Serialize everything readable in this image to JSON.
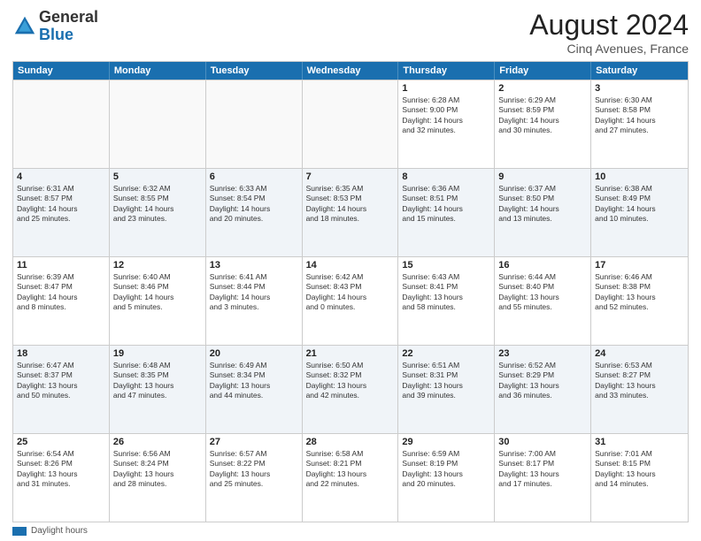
{
  "header": {
    "logo_general": "General",
    "logo_blue": "Blue",
    "month_year": "August 2024",
    "location": "Cinq Avenues, France"
  },
  "calendar": {
    "days_of_week": [
      "Sunday",
      "Monday",
      "Tuesday",
      "Wednesday",
      "Thursday",
      "Friday",
      "Saturday"
    ],
    "rows": [
      {
        "cells": [
          {
            "day": "",
            "info": "",
            "empty": true
          },
          {
            "day": "",
            "info": "",
            "empty": true
          },
          {
            "day": "",
            "info": "",
            "empty": true
          },
          {
            "day": "",
            "info": "",
            "empty": true
          },
          {
            "day": "1",
            "info": "Sunrise: 6:28 AM\nSunset: 9:00 PM\nDaylight: 14 hours\nand 32 minutes."
          },
          {
            "day": "2",
            "info": "Sunrise: 6:29 AM\nSunset: 8:59 PM\nDaylight: 14 hours\nand 30 minutes."
          },
          {
            "day": "3",
            "info": "Sunrise: 6:30 AM\nSunset: 8:58 PM\nDaylight: 14 hours\nand 27 minutes."
          }
        ]
      },
      {
        "alt": true,
        "cells": [
          {
            "day": "4",
            "info": "Sunrise: 6:31 AM\nSunset: 8:57 PM\nDaylight: 14 hours\nand 25 minutes."
          },
          {
            "day": "5",
            "info": "Sunrise: 6:32 AM\nSunset: 8:55 PM\nDaylight: 14 hours\nand 23 minutes."
          },
          {
            "day": "6",
            "info": "Sunrise: 6:33 AM\nSunset: 8:54 PM\nDaylight: 14 hours\nand 20 minutes."
          },
          {
            "day": "7",
            "info": "Sunrise: 6:35 AM\nSunset: 8:53 PM\nDaylight: 14 hours\nand 18 minutes."
          },
          {
            "day": "8",
            "info": "Sunrise: 6:36 AM\nSunset: 8:51 PM\nDaylight: 14 hours\nand 15 minutes."
          },
          {
            "day": "9",
            "info": "Sunrise: 6:37 AM\nSunset: 8:50 PM\nDaylight: 14 hours\nand 13 minutes."
          },
          {
            "day": "10",
            "info": "Sunrise: 6:38 AM\nSunset: 8:49 PM\nDaylight: 14 hours\nand 10 minutes."
          }
        ]
      },
      {
        "cells": [
          {
            "day": "11",
            "info": "Sunrise: 6:39 AM\nSunset: 8:47 PM\nDaylight: 14 hours\nand 8 minutes."
          },
          {
            "day": "12",
            "info": "Sunrise: 6:40 AM\nSunset: 8:46 PM\nDaylight: 14 hours\nand 5 minutes."
          },
          {
            "day": "13",
            "info": "Sunrise: 6:41 AM\nSunset: 8:44 PM\nDaylight: 14 hours\nand 3 minutes."
          },
          {
            "day": "14",
            "info": "Sunrise: 6:42 AM\nSunset: 8:43 PM\nDaylight: 14 hours\nand 0 minutes."
          },
          {
            "day": "15",
            "info": "Sunrise: 6:43 AM\nSunset: 8:41 PM\nDaylight: 13 hours\nand 58 minutes."
          },
          {
            "day": "16",
            "info": "Sunrise: 6:44 AM\nSunset: 8:40 PM\nDaylight: 13 hours\nand 55 minutes."
          },
          {
            "day": "17",
            "info": "Sunrise: 6:46 AM\nSunset: 8:38 PM\nDaylight: 13 hours\nand 52 minutes."
          }
        ]
      },
      {
        "alt": true,
        "cells": [
          {
            "day": "18",
            "info": "Sunrise: 6:47 AM\nSunset: 8:37 PM\nDaylight: 13 hours\nand 50 minutes."
          },
          {
            "day": "19",
            "info": "Sunrise: 6:48 AM\nSunset: 8:35 PM\nDaylight: 13 hours\nand 47 minutes."
          },
          {
            "day": "20",
            "info": "Sunrise: 6:49 AM\nSunset: 8:34 PM\nDaylight: 13 hours\nand 44 minutes."
          },
          {
            "day": "21",
            "info": "Sunrise: 6:50 AM\nSunset: 8:32 PM\nDaylight: 13 hours\nand 42 minutes."
          },
          {
            "day": "22",
            "info": "Sunrise: 6:51 AM\nSunset: 8:31 PM\nDaylight: 13 hours\nand 39 minutes."
          },
          {
            "day": "23",
            "info": "Sunrise: 6:52 AM\nSunset: 8:29 PM\nDaylight: 13 hours\nand 36 minutes."
          },
          {
            "day": "24",
            "info": "Sunrise: 6:53 AM\nSunset: 8:27 PM\nDaylight: 13 hours\nand 33 minutes."
          }
        ]
      },
      {
        "cells": [
          {
            "day": "25",
            "info": "Sunrise: 6:54 AM\nSunset: 8:26 PM\nDaylight: 13 hours\nand 31 minutes."
          },
          {
            "day": "26",
            "info": "Sunrise: 6:56 AM\nSunset: 8:24 PM\nDaylight: 13 hours\nand 28 minutes."
          },
          {
            "day": "27",
            "info": "Sunrise: 6:57 AM\nSunset: 8:22 PM\nDaylight: 13 hours\nand 25 minutes."
          },
          {
            "day": "28",
            "info": "Sunrise: 6:58 AM\nSunset: 8:21 PM\nDaylight: 13 hours\nand 22 minutes."
          },
          {
            "day": "29",
            "info": "Sunrise: 6:59 AM\nSunset: 8:19 PM\nDaylight: 13 hours\nand 20 minutes."
          },
          {
            "day": "30",
            "info": "Sunrise: 7:00 AM\nSunset: 8:17 PM\nDaylight: 13 hours\nand 17 minutes."
          },
          {
            "day": "31",
            "info": "Sunrise: 7:01 AM\nSunset: 8:15 PM\nDaylight: 13 hours\nand 14 minutes."
          }
        ]
      }
    ]
  },
  "footer": {
    "daylight_label": "Daylight hours"
  }
}
